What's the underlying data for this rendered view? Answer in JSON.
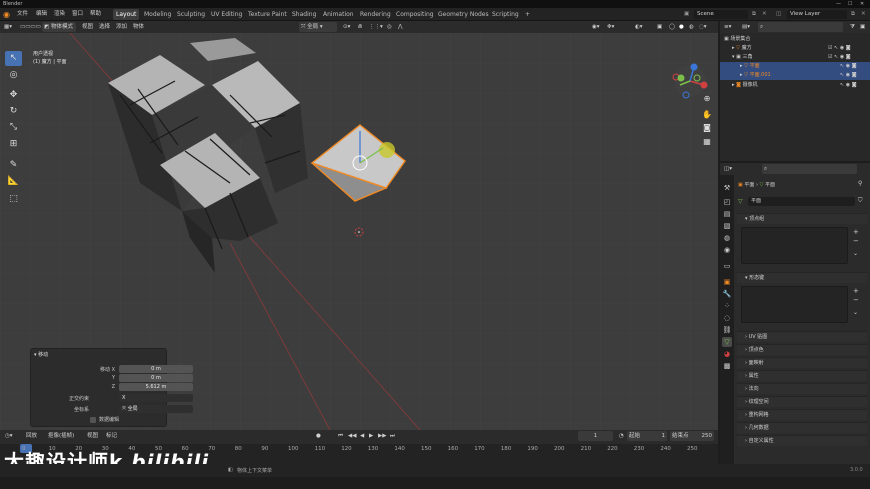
{
  "titlebar": {
    "title": "Blender"
  },
  "menubar": {
    "items": [
      "文件",
      "编辑",
      "渲染",
      "窗口",
      "帮助"
    ],
    "workspaces": [
      "Layout",
      "Modeling",
      "Sculpting",
      "UV Editing",
      "Texture Paint",
      "Shading",
      "Animation",
      "Rendering",
      "Compositing",
      "Geometry Nodes",
      "Scripting",
      "+"
    ],
    "active_workspace": "Layout",
    "scene": "Scene",
    "view_layer": "View Layer"
  },
  "viewport_header": {
    "mode": "物体模式",
    "menus": [
      "视图",
      "选择",
      "添加",
      "物体"
    ],
    "transform_orientation": "全局",
    "options_label": "选项"
  },
  "viewport": {
    "view_name": "用户透视",
    "collection_info": "(1) 魔方 | 平面"
  },
  "operator_panel": {
    "title": "移动",
    "fields": [
      {
        "label": "移动 X",
        "value": "0 m"
      },
      {
        "label": "Y",
        "value": "0 m"
      },
      {
        "label": "Z",
        "value": "5.612 m"
      }
    ],
    "constraint_label": "正交约束",
    "constraint_value": "X",
    "orientation_label": "坐标系",
    "orientation_value": "全局",
    "checkbox_label": "数据编辑"
  },
  "timeline": {
    "menus": [
      "回放",
      "抠像(插帧)",
      "视图",
      "标记"
    ],
    "current_frame": "1",
    "start_label": "起始",
    "start": "1",
    "end_label": "结束点",
    "end": "250",
    "ticks": [
      "0",
      "10",
      "20",
      "30",
      "40",
      "50",
      "60",
      "70",
      "80",
      "90",
      "100",
      "110",
      "120",
      "130",
      "140",
      "150",
      "160",
      "170",
      "180",
      "190",
      "200",
      "210",
      "220",
      "230",
      "240",
      "250"
    ],
    "watermark": "大趣设计师k",
    "watermark_logo": "bilibili"
  },
  "statusbar": {
    "hint": "物体上下文菜单",
    "version": "3.0.0"
  },
  "outliner": {
    "rows": [
      {
        "label": "场景集合",
        "indent": 0,
        "selected": false
      },
      {
        "label": "魔方",
        "indent": 1,
        "selected": false
      },
      {
        "label": "三角",
        "indent": 1,
        "selected": false
      },
      {
        "label": "平面",
        "indent": 2,
        "selected": true,
        "orange": true
      },
      {
        "label": "平面.001",
        "indent": 2,
        "selected": true,
        "orange": true
      },
      {
        "label": "摄像机",
        "indent": 1,
        "selected": false
      }
    ]
  },
  "properties": {
    "breadcrumb_object": "平面",
    "breadcrumb_data": "平面",
    "data_name": "平面",
    "panels": [
      "顶点组",
      "形态键",
      "UV 贴图",
      "顶点色",
      "面映射",
      "属性",
      "法向",
      "纹理空间",
      "重构网格",
      "几何数据",
      "自定义属性"
    ]
  },
  "colors": {
    "accent": "#4772b3",
    "selection_orange": "#f08a24",
    "viewport_bg": "#3d3d3d"
  }
}
